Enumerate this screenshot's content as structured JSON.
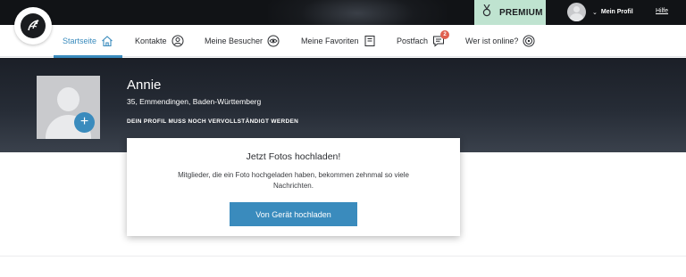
{
  "topbar": {
    "premium_label": "PREMIUM",
    "profile_label": "Mein Profil",
    "help_label": "Hilfe"
  },
  "nav": {
    "items": [
      {
        "label": "Startseite",
        "icon": "home-icon",
        "active": true
      },
      {
        "label": "Kontakte",
        "icon": "person-icon"
      },
      {
        "label": "Meine Besucher",
        "icon": "eye-icon"
      },
      {
        "label": "Meine Favoriten",
        "icon": "bookmark-icon"
      },
      {
        "label": "Postfach",
        "icon": "message-icon",
        "badge": "2"
      },
      {
        "label": "Wer ist online?",
        "icon": "online-icon"
      }
    ]
  },
  "profile": {
    "name": "Annie",
    "location": "35, Emmendingen, Baden-Württemberg",
    "notice": "DEIN PROFIL MUSS NOCH VERVOLLSTÄNDIGT WERDEN"
  },
  "upload_card": {
    "title": "Jetzt Fotos hochladen!",
    "text": "Mitglieder, die ein Foto hochgeladen haben, bekommen zehnmal so viele Nachrichten.",
    "button_label": "Von Gerät hochladen"
  },
  "colors": {
    "accent": "#3a8bbd",
    "premium_bg": "#bfe3d0",
    "badge": "#e06050",
    "topbar": "#111316"
  }
}
